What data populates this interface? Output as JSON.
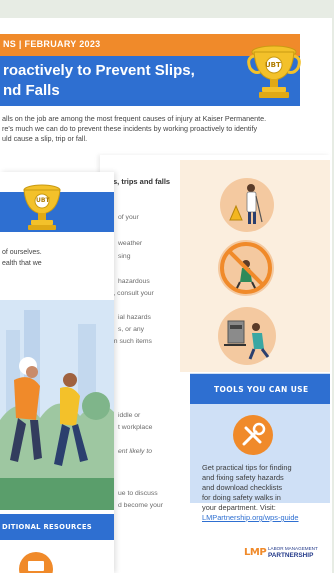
{
  "newsletter": {
    "series_date": "NS | FEBRUARY 2023",
    "headline_1": "roactively to Prevent Slips,",
    "headline_2": "nd Falls",
    "trophy_label": "UBT",
    "intro_1": "alls on the job are among the most frequent causes of injury at Kaiser Permanente.",
    "intro_2": "re's much we can do to prevent these incidents by working proactively to identify",
    "intro_3": "uld cause a slip, trip or fall."
  },
  "left_page": {
    "trophy_label": "UBT",
    "body_1": "of ourselves.",
    "body_2": "ealth that we",
    "footer_banner": "DITIONAL RESOURCES"
  },
  "middle_page": {
    "heading": "s, trips and falls",
    "lines": [
      "of your",
      "weather",
      "sing",
      "hazardous",
      "s, consult your",
      "ial hazards",
      "s, or any",
      "en such items",
      "iddle or",
      "t workplace",
      "ent likely to",
      "ue to discuss",
      "d become your"
    ]
  },
  "tools": {
    "heading": "TOOLS YOU CAN USE",
    "body": [
      "Get practical tips for finding",
      "and fixing safety hazards",
      "and download checklists",
      "for doing safety walks in",
      "your department. Visit:"
    ],
    "link": "LMPartnership.org/wps-guide"
  },
  "footer": {
    "logo_letters": "LMP",
    "logo_line_1": "LABOR MANAGEMENT",
    "logo_line_2": "PARTNERSHIP"
  },
  "colors": {
    "orange": "#f08a2a",
    "blue": "#2e6fd1",
    "navy": "#233a8a",
    "trophy_gold": "#f3c12a",
    "panel_peach": "#fbeede",
    "panel_blue": "#cfe0f6",
    "background": "#e7ece4"
  }
}
